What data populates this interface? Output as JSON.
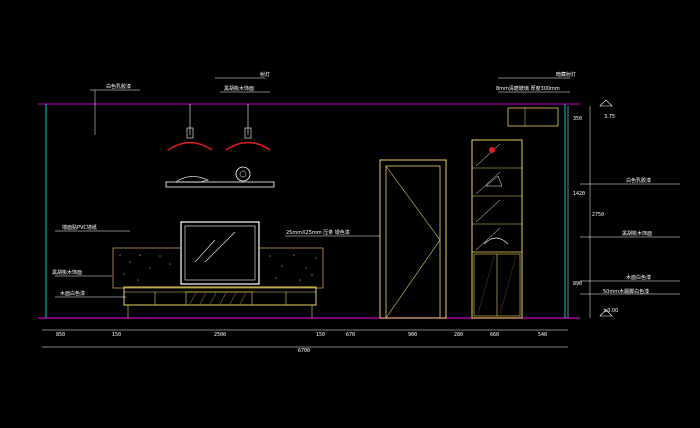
{
  "labels": {
    "top_left_ceiling": "白色乳胶漆",
    "pendant_light": "射灯",
    "black_mirror": "黑胡桃木饰面",
    "glass_shelf_top": "暗藏射灯",
    "glass_shelf_desc": "8mm清磨玻璃 厚度300mm",
    "wall_wallpaper": "墙面贴PVC墙纸",
    "strip_trim": "25mmX25mm 压条 银色漆",
    "walnut_veneer": "黑胡桃木饰面",
    "wood_white": "木面白色漆",
    "right_white_paint": "白色乳胶漆",
    "right_walnut": "黑胡桃木饰面",
    "right_wood_white": "木面白色漆",
    "right_baseboard": "50mm木踢脚白色漆",
    "elev_top": "3.75",
    "elev_bottom": "±0.00"
  },
  "dims_bottom": [
    "850",
    "150",
    "2500",
    "150",
    "670",
    "900",
    "280",
    "660",
    "540"
  ],
  "dim_total": "6700",
  "dims_right": [
    "350",
    "1420",
    "890"
  ],
  "dim_right_total": "2750"
}
